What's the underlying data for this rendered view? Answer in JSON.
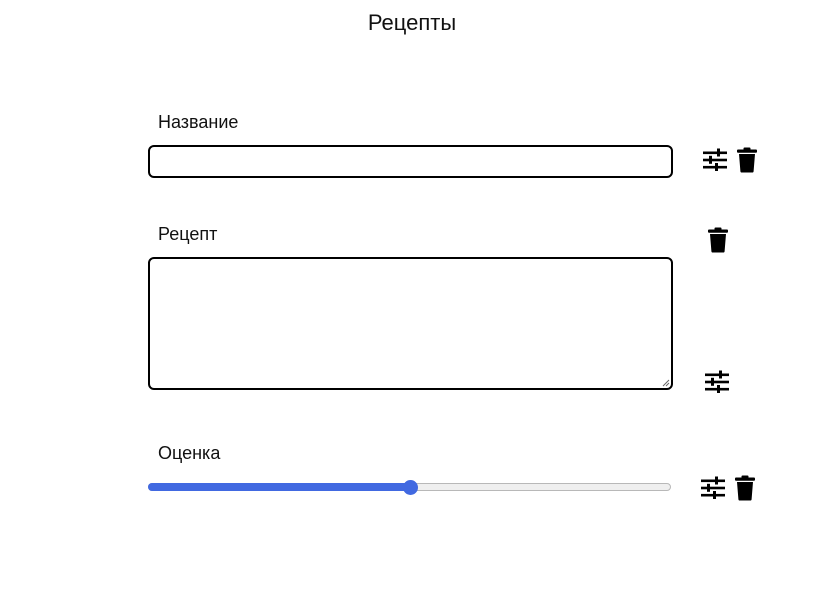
{
  "page": {
    "title": "Рецепты"
  },
  "fields": {
    "name": {
      "label": "Название",
      "value": "",
      "placeholder": ""
    },
    "recipe": {
      "label": "Рецепт",
      "value": "",
      "placeholder": ""
    },
    "rating": {
      "label": "Оценка",
      "value_fraction": 0.5
    }
  },
  "icons": {
    "settings": "sliders-icon",
    "delete": "trash-icon"
  },
  "colors": {
    "accent": "#4169e1",
    "text": "#111111",
    "border": "#000000"
  }
}
